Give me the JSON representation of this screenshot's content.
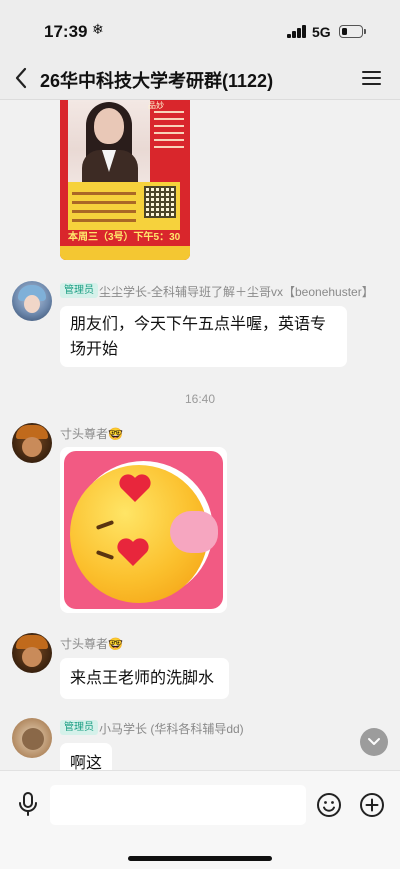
{
  "status_bar": {
    "time": "17:39",
    "sync_icon": "❄",
    "network": "5G"
  },
  "header": {
    "title": "26华中科技大学考研群(1122)"
  },
  "poster": {
    "name_label": "品妙",
    "date_line": "本周三（3号）下午5：30"
  },
  "messages": [
    {
      "sender": "尘尘学长-全科辅导班了解＋尘哥vx【beonehuster】",
      "role": "管理员",
      "text": "朋友们，今天下午五点半喔，英语专场开始"
    },
    {
      "sender": "寸头尊者🤓",
      "role": "",
      "text": ""
    },
    {
      "sender": "寸头尊者🤓",
      "role": "",
      "text": "来点王老师的洗脚水"
    },
    {
      "sender": "小马学长 (华科各科辅导dd)",
      "role": "管理员",
      "text": "啊这"
    }
  ],
  "time_divider": "16:40",
  "input": {
    "value": "",
    "placeholder": ""
  },
  "colors": {
    "admin_badge_bg": "#d5f1ea",
    "admin_badge_text": "#1a9e83",
    "bubble_bg": "#ffffff",
    "chat_bg": "#f1f1f1"
  }
}
